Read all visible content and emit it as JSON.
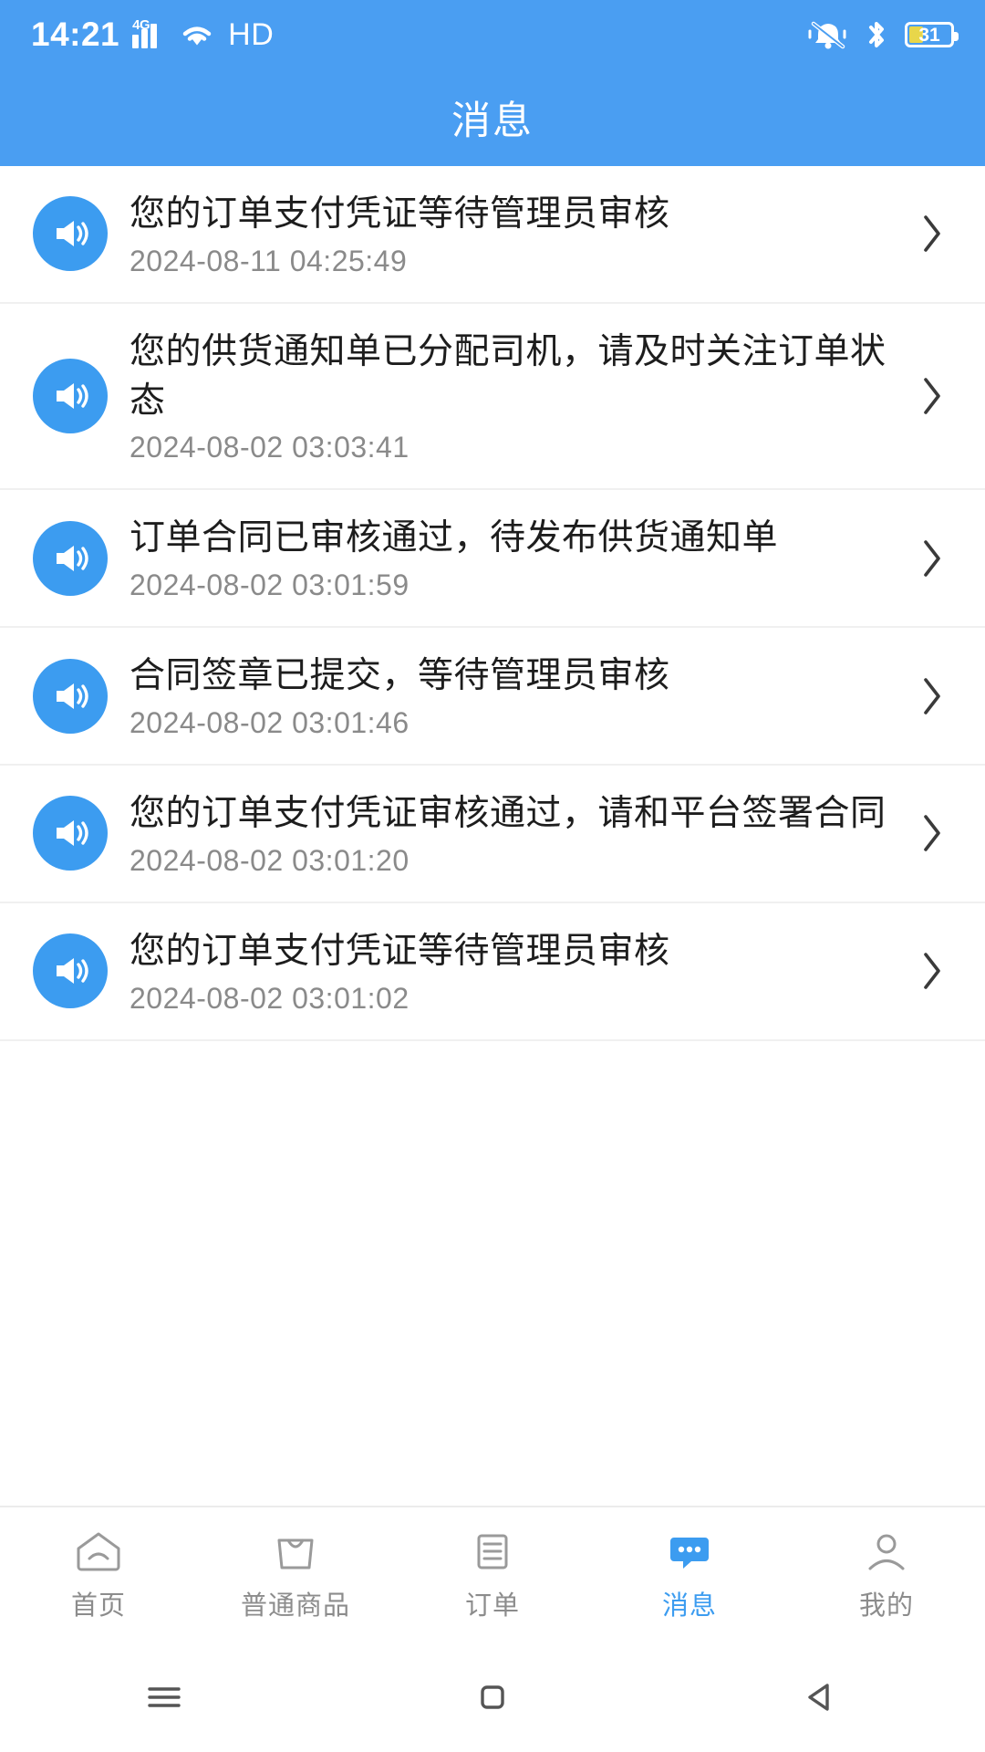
{
  "statusbar": {
    "time": "14:21",
    "network_type": "4G",
    "hd_label": "HD",
    "battery_percent": "31",
    "icons": [
      "signal-4g-icon",
      "wifi-icon",
      "hd-icon",
      "mute-bell-icon",
      "bluetooth-icon",
      "battery-icon"
    ]
  },
  "header": {
    "title": "消息"
  },
  "messages": [
    {
      "title": "您的订单支付凭证等待管理员审核",
      "time": "2024-08-11 04:25:49"
    },
    {
      "title": "您的供货通知单已分配司机，请及时关注订单状态",
      "time": "2024-08-02 03:03:41"
    },
    {
      "title": "订单合同已审核通过，待发布供货通知单",
      "time": "2024-08-02 03:01:59"
    },
    {
      "title": "合同签章已提交，等待管理员审核",
      "time": "2024-08-02 03:01:46"
    },
    {
      "title": "您的订单支付凭证审核通过，请和平台签署合同",
      "time": "2024-08-02 03:01:20"
    },
    {
      "title": "您的订单支付凭证等待管理员审核",
      "time": "2024-08-02 03:01:02"
    }
  ],
  "tabbar": {
    "items": [
      {
        "label": "首页",
        "icon": "home-icon",
        "active": false
      },
      {
        "label": "普通商品",
        "icon": "bag-icon",
        "active": false
      },
      {
        "label": "订单",
        "icon": "list-icon",
        "active": false
      },
      {
        "label": "消息",
        "icon": "chat-bubble-icon",
        "active": true
      },
      {
        "label": "我的",
        "icon": "person-icon",
        "active": false
      }
    ]
  },
  "sysnav": {
    "buttons": [
      "menu-icon",
      "home-square-icon",
      "back-triangle-icon"
    ]
  },
  "colors": {
    "brand_blue": "#4a9ef2",
    "icon_blue": "#3c9cf0",
    "active_tab": "#3c9cf0",
    "title_text": "#1d1d1d",
    "time_text": "#8a8a8a",
    "tab_inactive": "#8c8c8c",
    "battery_fill": "#e8d64a"
  }
}
